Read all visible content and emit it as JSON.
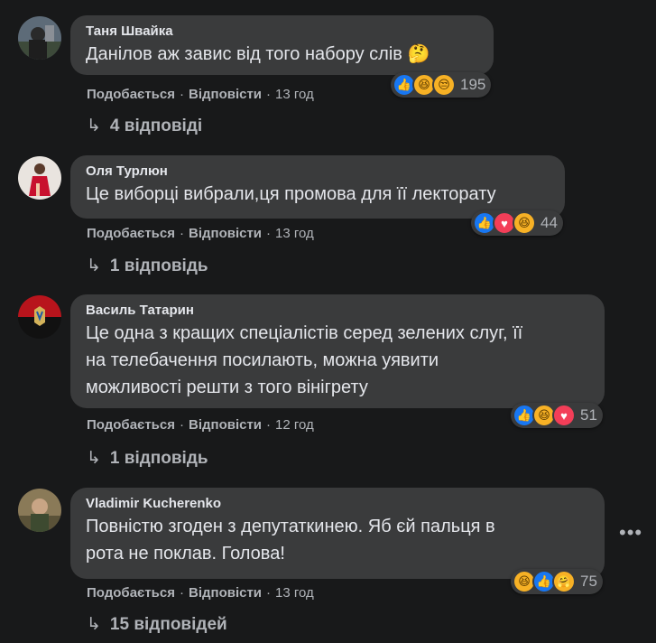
{
  "comments": [
    {
      "author": "Таня Швайка",
      "text": "Данілов аж завис від того набору слів",
      "emoji_inline": "🤔",
      "like_label": "Подобається",
      "reply_label": "Відповісти",
      "time": "13 год",
      "reaction_count": "195",
      "replies": "4 відповіді"
    },
    {
      "author": "Оля Турлюн",
      "text": "Це виборці вибрали,ця промова для її лекторату",
      "like_label": "Подобається",
      "reply_label": "Відповісти",
      "time": "13 год",
      "reaction_count": "44",
      "replies": "1 відповідь"
    },
    {
      "author": "Василь Татарин",
      "text_lines": [
        "Це одна з кращих спеціалістів серед зелених слуг, її",
        "на телебачення посилають, можна уявити",
        "можливості решти з того вінігрету"
      ],
      "like_label": "Подобається",
      "reply_label": "Відповісти",
      "time": "12 год",
      "reaction_count": "51",
      "replies": "1 відповідь"
    },
    {
      "author": "Vladimir Kucherenko",
      "text_lines": [
        "Повністю згоден з депутаткинею. Яб єй пальця в",
        "рота не поклав. Голова!"
      ],
      "like_label": "Подобається",
      "reply_label": "Відповісти",
      "time": "13 год",
      "reaction_count": "75",
      "replies": "15 відповідей"
    }
  ],
  "colors": {
    "background": "#18191a",
    "bubble": "#3a3b3c",
    "text": "#e4e6eb",
    "secondary": "#b0b3b8",
    "like_blue": "#1877f2",
    "love_red": "#f33e58",
    "emoji_yellow": "#f7b125"
  }
}
